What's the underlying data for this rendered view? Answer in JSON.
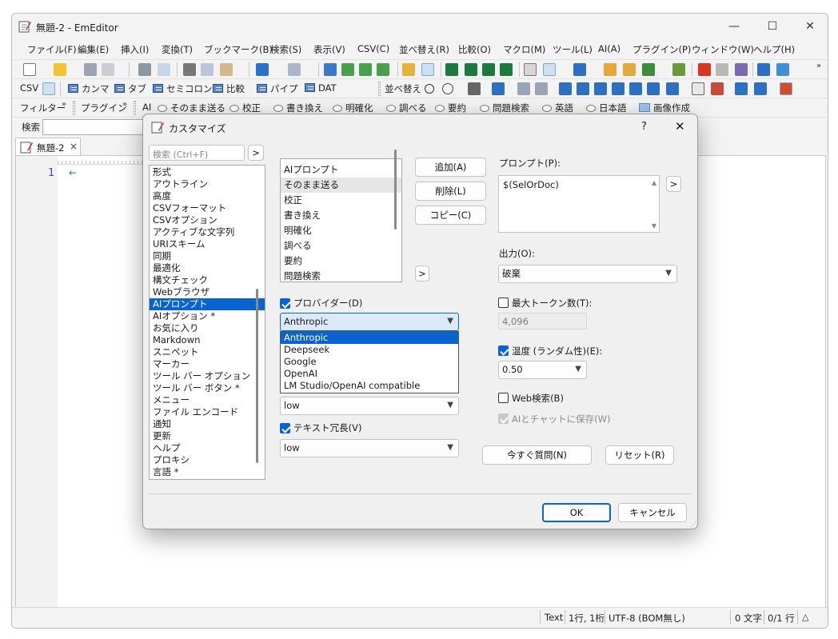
{
  "window": {
    "title": "無題-2 - EmEditor",
    "controls": [
      "—",
      "☐",
      "✕"
    ]
  },
  "menu": [
    "ファイル(F)",
    "編集(E)",
    "挿入(I)",
    "変換(T)",
    "ブックマーク(B)",
    "検索(S)",
    "表示(V)",
    "CSV(C)",
    "並べ替え(R)",
    "比較(O)",
    "マクロ(M)",
    "ツール(L)",
    "AI(A)",
    "プラグイン(P)",
    "ウィンドウ(W)",
    "ヘルプ(H)"
  ],
  "toolbar_more": "»",
  "csv_bar": {
    "csv": "CSV",
    "items": [
      "カンマ",
      "タブ",
      "セミコロン",
      "比較",
      "パイプ",
      "DAT"
    ],
    "sort": "並べ替え"
  },
  "filter_bar": {
    "filter": "フィルター",
    "plugin": "プラグイン",
    "ai": "AI",
    "ai_items": [
      "そのまま送る",
      "校正",
      "書き換え",
      "明確化",
      "調べる",
      "要約",
      "問題検索",
      "英語",
      "日本語"
    ],
    "image_gen": "画像作成"
  },
  "search_bar": {
    "label": "検索"
  },
  "doc_tab": {
    "label": "無題-2",
    "close": "×"
  },
  "editor": {
    "line_number": "1",
    "eol_mark": "←"
  },
  "status": {
    "mode": "Text",
    "position": "1行, 1桁",
    "encoding": "UTF-8 (BOM無し)",
    "chars": "0 文字",
    "lines": "0/1 行"
  },
  "dialog": {
    "title": "カスタマイズ",
    "help": "?",
    "close": "✕",
    "search_placeholder": "検索 (Ctrl+F)",
    "search_go": ">",
    "categories": [
      "形式",
      "アウトライン",
      "高度",
      "CSVフォーマット",
      "CSVオプション",
      "アクティブな文字列",
      "URIスキーム",
      "同期",
      "最適化",
      "構文チェック",
      "Webブラウザ",
      "AIプロンプト",
      "AIオプション *",
      "お気に入り",
      "Markdown",
      "スニペット",
      "マーカー",
      "ツール バー オプション",
      "ツール バー ボタン *",
      "メニュー",
      "ファイル エンコード",
      "通知",
      "更新",
      "ヘルプ",
      "プロキシ",
      "言語 *"
    ],
    "selected_category": "AIプロンプト",
    "prompts": [
      "AIプロンプト",
      "そのまま送る",
      "校正",
      "書き換え",
      "明確化",
      "調べる",
      "要約",
      "問題検索"
    ],
    "selected_prompt": "そのまま送る",
    "buttons": {
      "add": "追加(A)",
      "delete": "削除(L)",
      "copy": "コピー(C)",
      "move": ">"
    },
    "prompt_label": "プロンプト(P):",
    "prompt_value": "$(SelOrDoc)",
    "prompt_insert": ">",
    "output_label": "出力(O):",
    "output_value": "破棄",
    "provider_label": "プロバイダー(D)",
    "provider_value": "Anthropic",
    "provider_options": [
      "Anthropic",
      "Deepseek",
      "Google",
      "OpenAI",
      "LM Studio/OpenAI compatible"
    ],
    "effort_value": "low",
    "verbosity_label": "テキスト冗長(V)",
    "verbosity_value": "low",
    "max_tokens_label": "最大トークン数(T):",
    "max_tokens_value": "4,096",
    "temperature_label": "温度 (ランダム性)(E):",
    "temperature_value": "0.50",
    "web_search_label": "Web検索(B)",
    "save_chat_label": "AIとチャットに保存(W)",
    "ask_now": "今すぐ質問(N)",
    "reset": "リセット(R)",
    "ok": "OK",
    "cancel": "キャンセル",
    "checks": {
      "provider": true,
      "verbosity": true,
      "max_tokens": false,
      "temperature": true,
      "web_search": false,
      "save_chat": true
    }
  },
  "colors": {
    "accent": "#0a64d0",
    "dialog_bg": "#f0f0f0",
    "window_bg": "#f3f3f3"
  }
}
